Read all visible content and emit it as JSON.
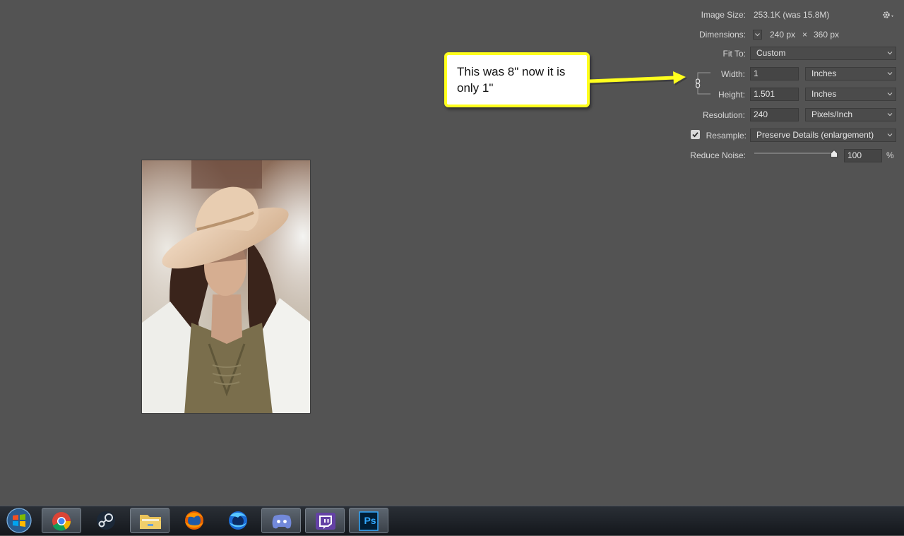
{
  "panel": {
    "image_size_label": "Image Size:",
    "image_size_value": "253.1K (was 15.8M)",
    "dimensions_label": "Dimensions:",
    "dimensions_w": "240 px",
    "dimensions_x": "×",
    "dimensions_h": "360 px",
    "fit_to_label": "Fit To:",
    "fit_to_value": "Custom",
    "width_label": "Width:",
    "width_value": "1",
    "width_unit": "Inches",
    "height_label": "Height:",
    "height_value": "1.501",
    "height_unit": "Inches",
    "resolution_label": "Resolution:",
    "resolution_value": "240",
    "resolution_unit": "Pixels/Inch",
    "resample_label": "Resample:",
    "resample_checked": true,
    "resample_value": "Preserve Details (enlargement)",
    "reduce_noise_label": "Reduce Noise:",
    "reduce_noise_value": "100",
    "reduce_noise_fraction": 0.9,
    "reduce_noise_unit": "%"
  },
  "callout": {
    "text_line1": "This was 8\" now it is",
    "text_line2": "only 1\""
  },
  "taskbar": {
    "items": [
      "start",
      "chrome",
      "steam",
      "file-explorer",
      "firefox",
      "firefox-developer",
      "discord",
      "twitch",
      "photoshop"
    ],
    "photoshop_label": "Ps"
  },
  "colors": {
    "workspace_bg": "#535353",
    "callout_border": "#ffff1e",
    "arrow": "#ffff1e",
    "photoshop_blue": "#31a8ff",
    "twitch_purple": "#6441a5",
    "discord_blurple": "#7289da"
  }
}
